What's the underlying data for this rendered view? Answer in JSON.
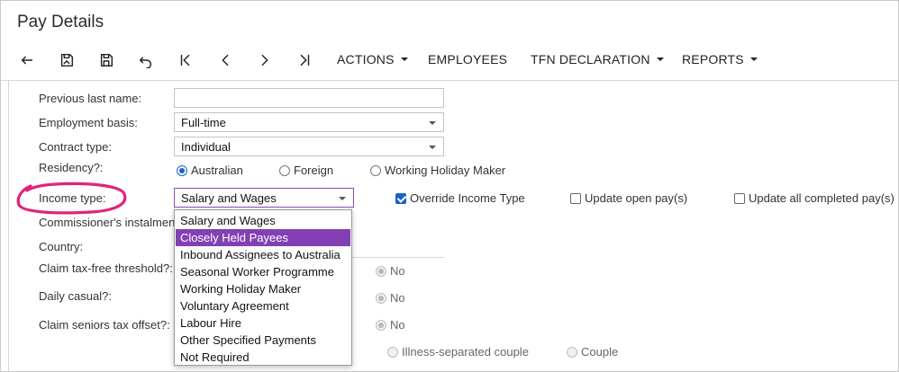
{
  "page": {
    "title": "Pay Details"
  },
  "toolbar": {
    "menus": [
      {
        "label": "ACTIONS",
        "has_caret": true
      },
      {
        "label": "EMPLOYEES",
        "has_caret": false
      },
      {
        "label": "TFN DECLARATION",
        "has_caret": true
      },
      {
        "label": "REPORTS",
        "has_caret": true
      }
    ],
    "icons": [
      "back-arrow-icon",
      "save-and-close-icon",
      "save-icon",
      "undo-icon",
      "first-record-icon",
      "previous-record-icon",
      "next-record-icon",
      "last-record-icon"
    ]
  },
  "form": {
    "previous_last_name": {
      "label": "Previous last name:",
      "value": ""
    },
    "employment_basis": {
      "label": "Employment basis:",
      "value": "Full-time"
    },
    "contract_type": {
      "label": "Contract type:",
      "value": "Individual"
    },
    "residency": {
      "label": "Residency?:",
      "options": [
        "Australian",
        "Foreign",
        "Working Holiday Maker"
      ],
      "selected": "Australian"
    },
    "income_type": {
      "label": "Income type:",
      "value": "Salary and Wages"
    },
    "override_income_type": {
      "label": "Override Income Type",
      "checked": true
    },
    "update_open_pay": {
      "label": "Update open pay(s)",
      "checked": false
    },
    "update_all_completed_pay": {
      "label": "Update all completed pay(s)",
      "checked": false
    },
    "commissioners_instalment": {
      "label": "Commissioner's instalmen"
    },
    "country": {
      "label": "Country:"
    },
    "claim_tax_free_threshold": {
      "label": "Claim tax-free threshold?:",
      "radio_label": "No"
    },
    "daily_casual": {
      "label": "Daily casual?:",
      "radio_label": "No"
    },
    "claim_seniors_tax_offset": {
      "label": "Claim seniors tax offset?:",
      "radio_label": "No"
    },
    "couple_status": {
      "options": [
        "Illness-separated couple",
        "Couple"
      ]
    }
  },
  "dropdown": {
    "items": [
      "Salary and Wages",
      "Closely Held Payees",
      "Inbound Assignees to Australia",
      "Seasonal Worker Programme",
      "Working Holiday Maker",
      "Voluntary Agreement",
      "Labour Hire",
      "Other Specified Payments",
      "Not Required"
    ],
    "highlighted": "Closely Held Payees"
  },
  "colors": {
    "accent": "#8240b3",
    "annotation": "#e0247a",
    "checkbox": "#1a62c7"
  }
}
